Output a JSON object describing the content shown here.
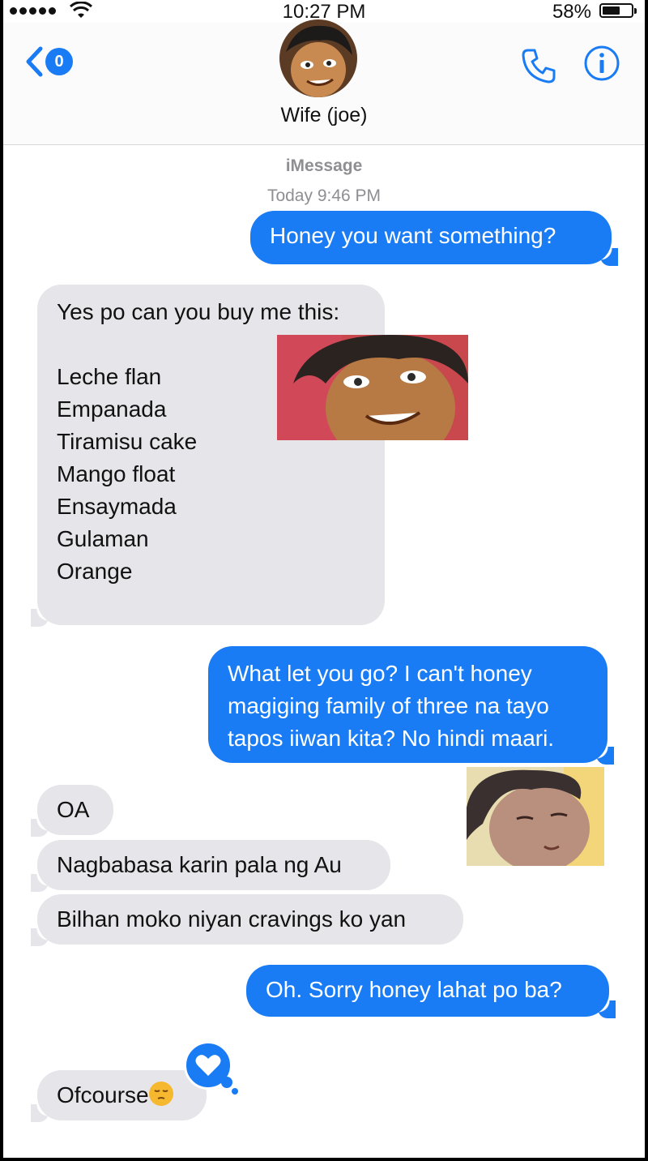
{
  "status_bar": {
    "time": "10:27 PM",
    "battery": "58%"
  },
  "header": {
    "back_count": "0",
    "contact_name": "Wife (joe)"
  },
  "thread": {
    "service": "iMessage",
    "timestamp": "Today 9:46 PM",
    "messages": [
      {
        "from": "me",
        "text": "Honey you want something?"
      },
      {
        "from": "them",
        "text": "Yes po can you buy me this:\n\nLeche flan\nEmpanada\nTiramisu cake\nMango float\nEnsaymada\nGulaman\nOrange"
      },
      {
        "from": "me",
        "text": "What let you go? I can't honey\nmagiging family of three na tayo\ntapos iiwan kita? No hindi maari."
      },
      {
        "from": "them",
        "text": "OA"
      },
      {
        "from": "them",
        "text": "Nagbabasa karin pala ng Au"
      },
      {
        "from": "them",
        "text": "Bilhan moko niyan cravings ko yan"
      },
      {
        "from": "me",
        "text": "Oh. Sorry honey lahat po ba?"
      },
      {
        "from": "them",
        "text": "Ofcourse"
      }
    ],
    "reaction": "heart"
  },
  "colors": {
    "accent": "#1a7cf5",
    "incoming_bubble": "#e6e6ea",
    "muted_text": "#8e8e93"
  }
}
